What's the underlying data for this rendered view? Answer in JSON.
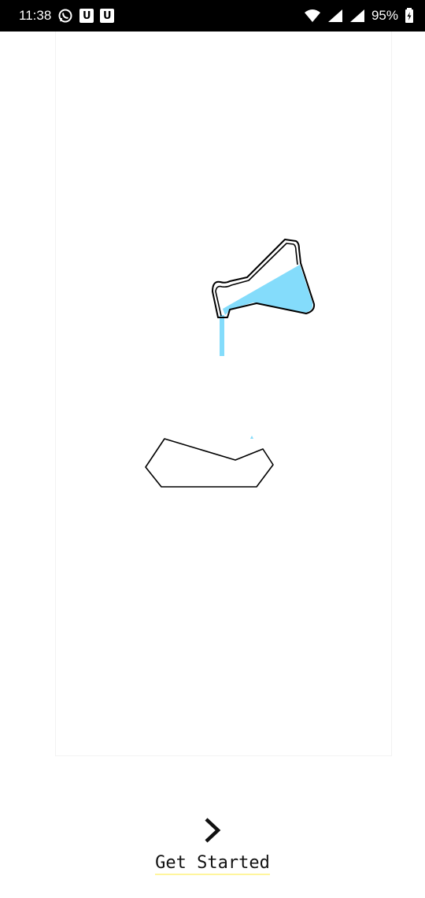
{
  "status_bar": {
    "time": "11:38",
    "notif_badge_1": "U",
    "notif_badge_2": "U",
    "battery": "95%",
    "icons": [
      "whatsapp-icon",
      "wifi-icon",
      "signal-icon",
      "signal-icon",
      "battery-charging-icon"
    ]
  },
  "onboarding": {
    "illustration": "beaker-pouring-icon",
    "liquid_color": "#84dcfb",
    "next_icon": "chevron-right-icon",
    "cta_label": "Get Started"
  }
}
